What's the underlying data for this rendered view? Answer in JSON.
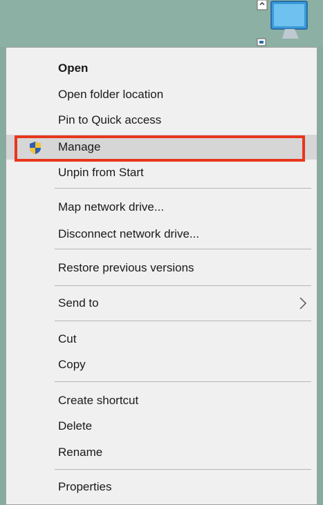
{
  "context_menu": {
    "items": [
      {
        "label": "Open",
        "bold": true
      },
      {
        "label": "Open folder location"
      },
      {
        "label": "Pin to Quick access"
      },
      {
        "label": "Manage",
        "icon": "uac-shield-icon",
        "highlighted": true
      },
      {
        "label": "Unpin from Start"
      },
      {
        "label": "Map network drive..."
      },
      {
        "label": "Disconnect network drive..."
      },
      {
        "label": "Restore previous versions"
      },
      {
        "label": "Send to",
        "submenu": true,
        "icon": "chevron-right-icon"
      },
      {
        "label": "Cut"
      },
      {
        "label": "Copy"
      },
      {
        "label": "Create shortcut"
      },
      {
        "label": "Delete"
      },
      {
        "label": "Rename"
      },
      {
        "label": "Properties"
      }
    ]
  },
  "highlight_color": "#e8361c",
  "desktop_icon": "this-pc-icon"
}
